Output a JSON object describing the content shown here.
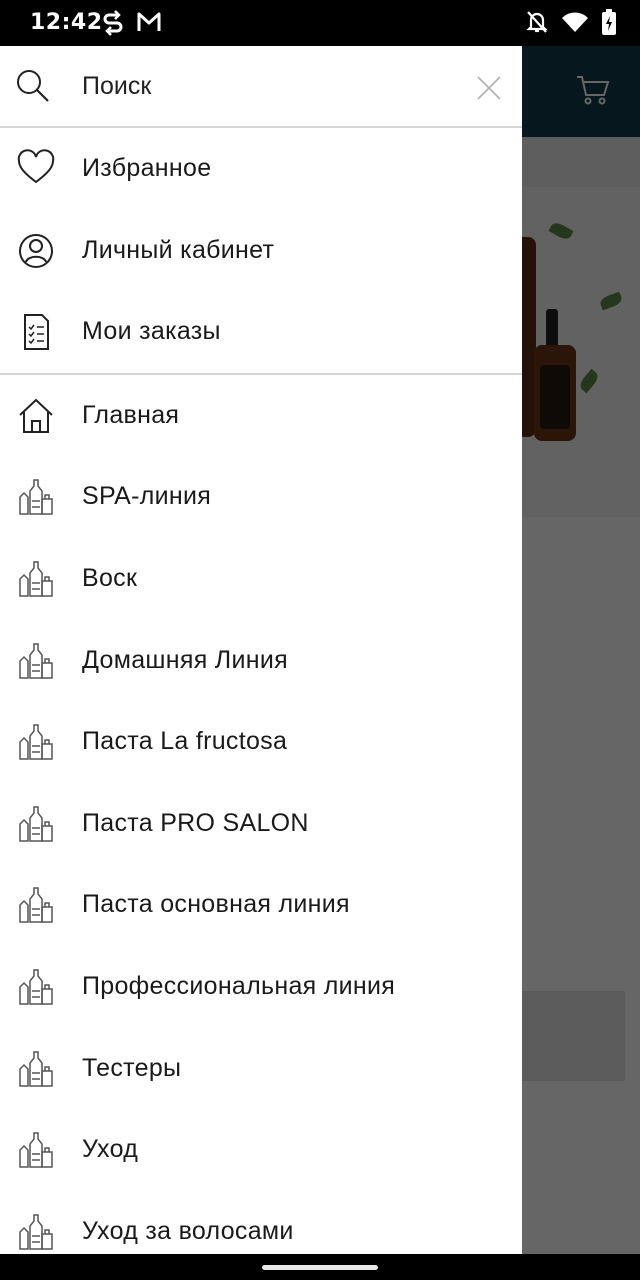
{
  "status_bar": {
    "time": "12:42",
    "left_icons": [
      "sync-icon",
      "gmail-icon"
    ],
    "right_icons": [
      "notifications-off-icon",
      "wifi-icon",
      "battery-charging-icon"
    ]
  },
  "background_app": {
    "header_color": "#0f3a4a",
    "cart_icon": "cart-icon"
  },
  "drawer": {
    "search": {
      "placeholder": "Поиск",
      "icon": "search-icon",
      "clear_icon": "close-icon"
    },
    "account_items": [
      {
        "label": "Избранное",
        "icon": "heart-icon"
      },
      {
        "label": "Личный кабинет",
        "icon": "user-icon"
      },
      {
        "label": "Мои заказы",
        "icon": "orders-icon"
      }
    ],
    "category_items": [
      {
        "label": "Главная",
        "icon": "home-icon"
      },
      {
        "label": "SPA-линия",
        "icon": "products-icon"
      },
      {
        "label": "Воск",
        "icon": "products-icon"
      },
      {
        "label": "Домашняя Линия",
        "icon": "products-icon"
      },
      {
        "label": "Паста La fructosa",
        "icon": "products-icon"
      },
      {
        "label": "Паста PRO SALON",
        "icon": "products-icon"
      },
      {
        "label": "Паста основная линия",
        "icon": "products-icon"
      },
      {
        "label": "Профессиональная линия",
        "icon": "products-icon"
      },
      {
        "label": "Тестеры",
        "icon": "products-icon"
      },
      {
        "label": "Уход",
        "icon": "products-icon"
      },
      {
        "label": "Уход за волосами",
        "icon": "products-icon"
      }
    ]
  }
}
